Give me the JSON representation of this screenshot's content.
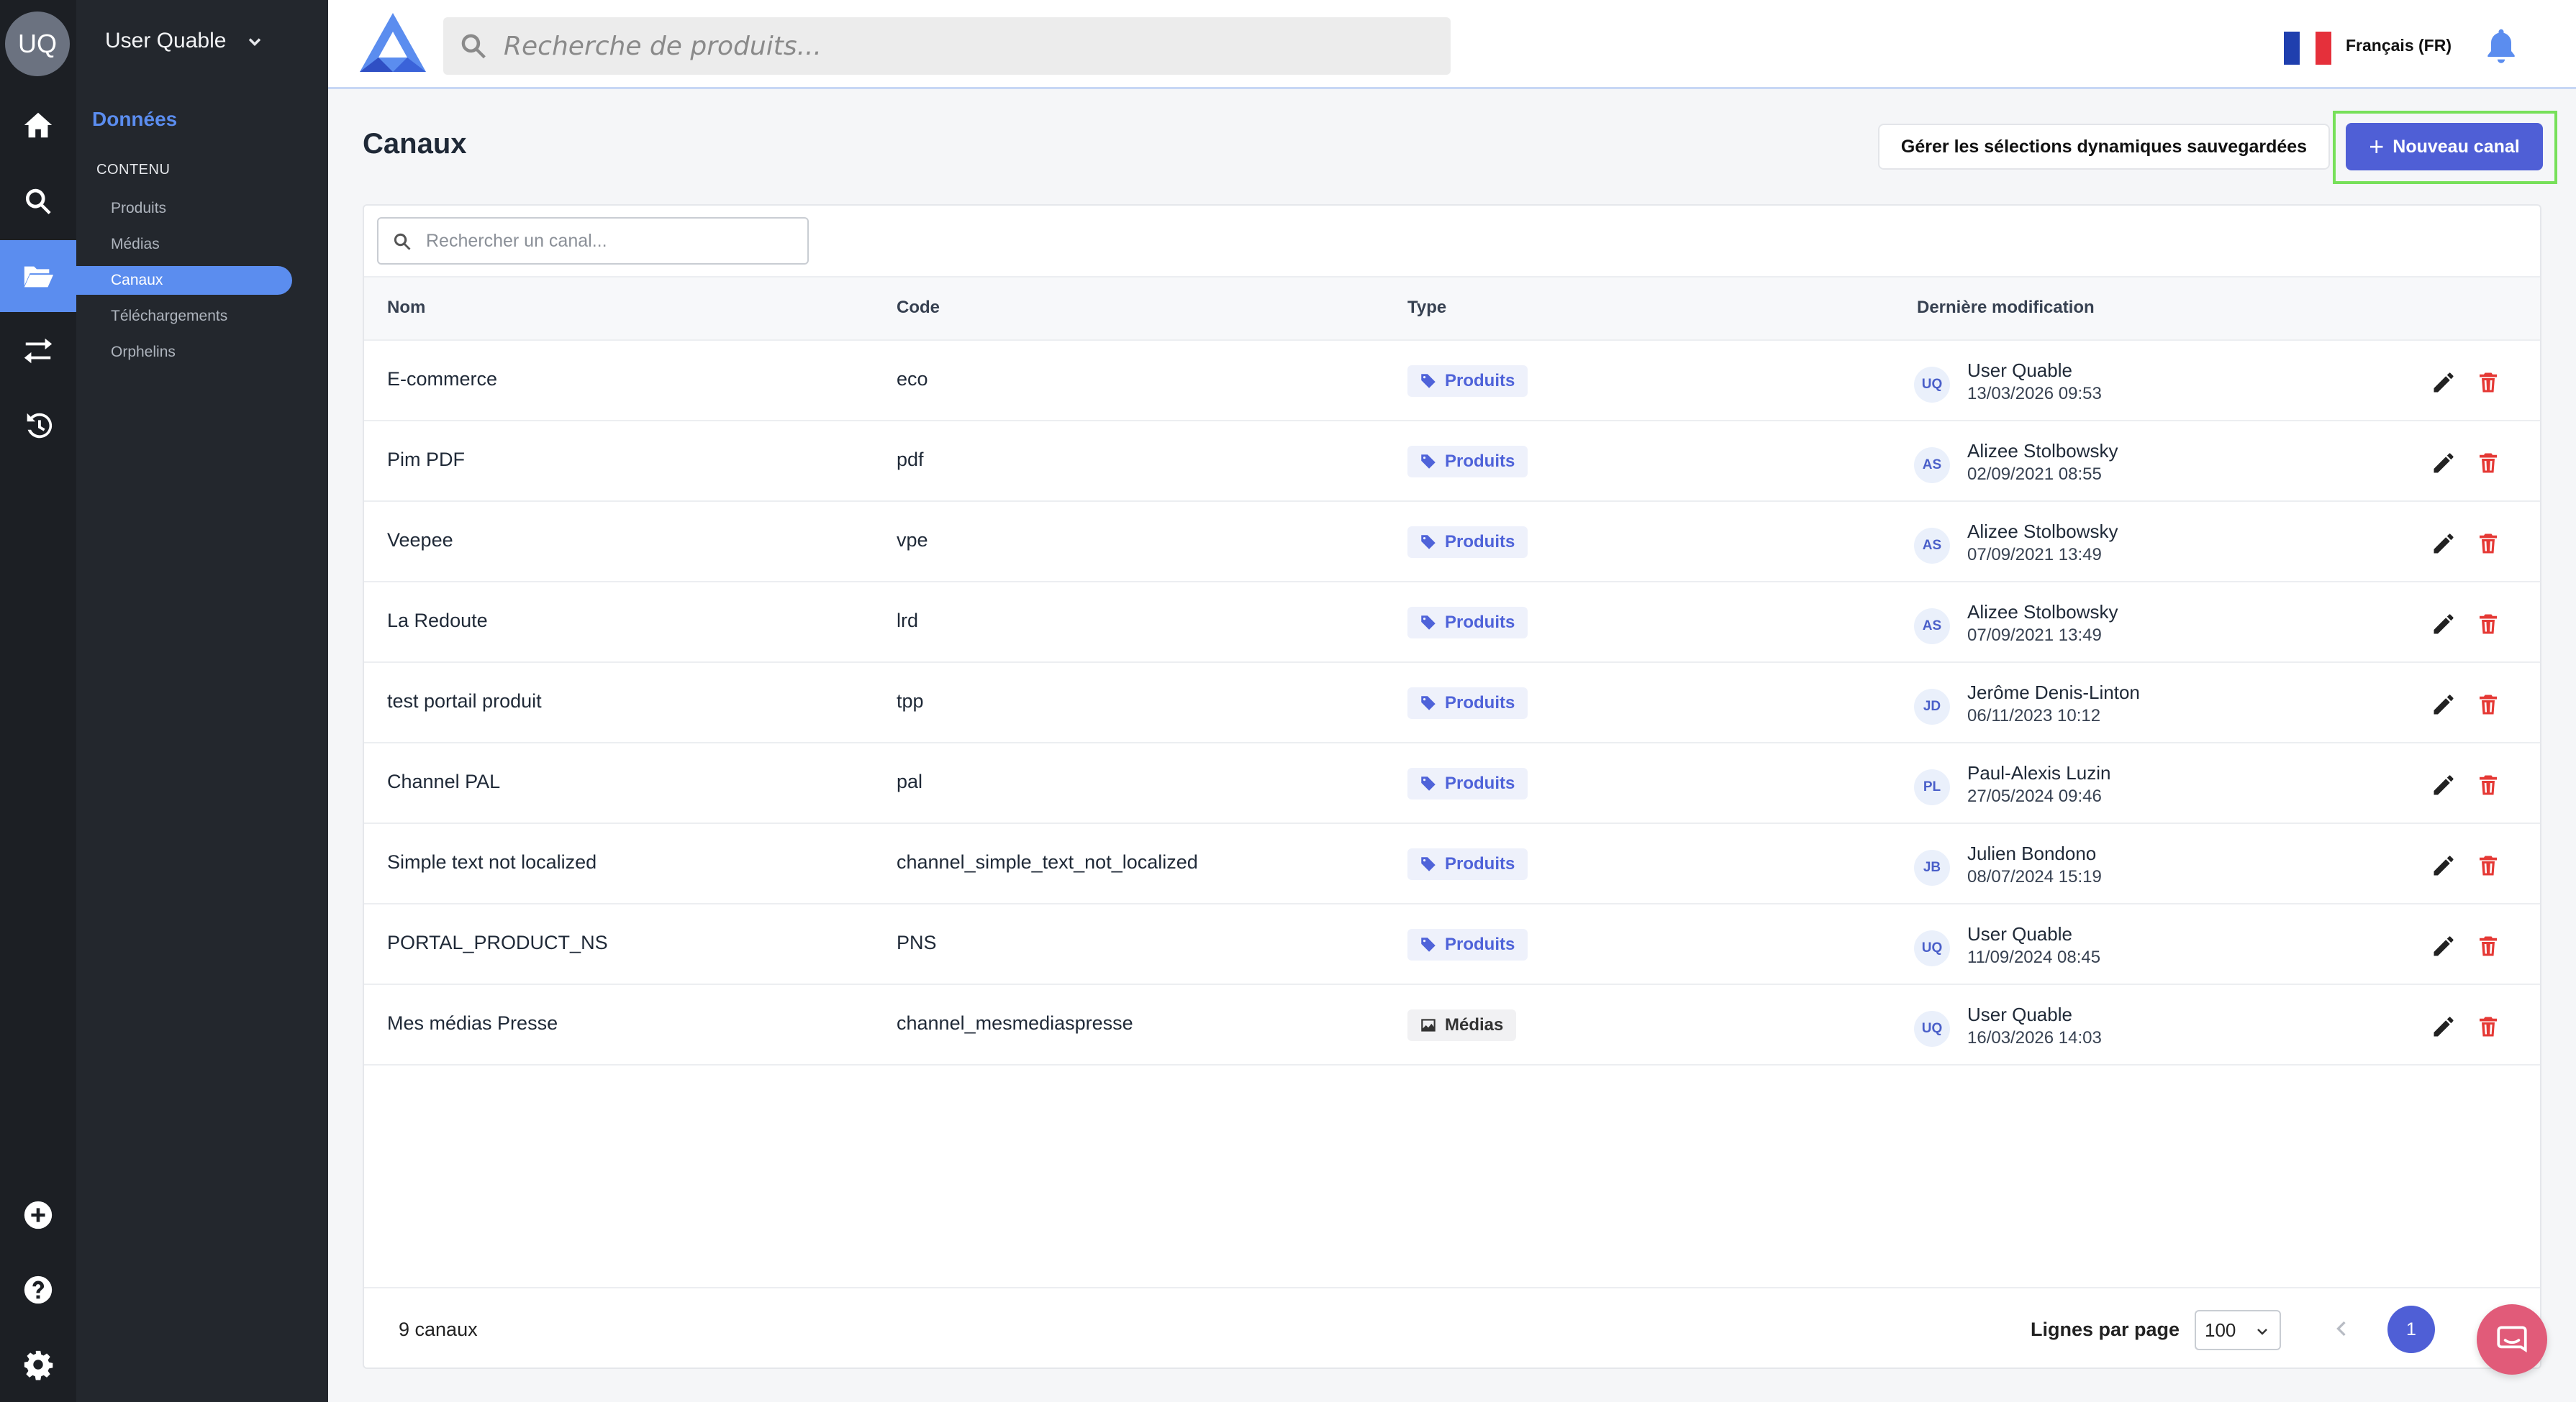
{
  "user": {
    "initials": "UQ",
    "name": "User Quable"
  },
  "sidebar": {
    "section_title": "Données",
    "group_title": "CONTENU",
    "items": [
      {
        "label": "Produits"
      },
      {
        "label": "Médias"
      },
      {
        "label": "Canaux"
      },
      {
        "label": "Téléchargements"
      },
      {
        "label": "Orphelins"
      }
    ]
  },
  "rail_icons": [
    "home-icon",
    "search-icon",
    "folder-open-icon",
    "swap-arrows-icon",
    "history-icon",
    "plus-circle-icon",
    "help-circle-icon",
    "gear-icon"
  ],
  "topbar": {
    "search_placeholder": "Recherche de produits...",
    "language": "Français (FR)"
  },
  "page": {
    "title": "Canaux",
    "manage_button": "Gérer les sélections dynamiques sauvegardées",
    "new_button": "Nouveau canal",
    "filter_placeholder": "Rechercher un canal..."
  },
  "table": {
    "columns": {
      "name": "Nom",
      "code": "Code",
      "type": "Type",
      "modified": "Dernière modification"
    },
    "rows": [
      {
        "name": "E-commerce",
        "code": "eco",
        "type": "Produits",
        "initials": "UQ",
        "user": "User Quable",
        "date": "13/03/2026 09:53"
      },
      {
        "name": "Pim PDF",
        "code": "pdf",
        "type": "Produits",
        "initials": "AS",
        "user": "Alizee Stolbowsky",
        "date": "02/09/2021 08:55"
      },
      {
        "name": "Veepee",
        "code": "vpe",
        "type": "Produits",
        "initials": "AS",
        "user": "Alizee Stolbowsky",
        "date": "07/09/2021 13:49"
      },
      {
        "name": "La Redoute",
        "code": "lrd",
        "type": "Produits",
        "initials": "AS",
        "user": "Alizee Stolbowsky",
        "date": "07/09/2021 13:49"
      },
      {
        "name": "test portail produit",
        "code": "tpp",
        "type": "Produits",
        "initials": "JD",
        "user": "Jerôme Denis-Linton",
        "date": "06/11/2023 10:12"
      },
      {
        "name": "Channel PAL",
        "code": "pal",
        "type": "Produits",
        "initials": "PL",
        "user": "Paul-Alexis Luzin",
        "date": "27/05/2024 09:46"
      },
      {
        "name": "Simple text not localized",
        "code": "channel_simple_text_not_localized",
        "type": "Produits",
        "initials": "JB",
        "user": "Julien Bondono",
        "date": "08/07/2024 15:19"
      },
      {
        "name": "PORTAL_PRODUCT_NS",
        "code": "PNS",
        "type": "Produits",
        "initials": "UQ",
        "user": "User Quable",
        "date": "11/09/2024 08:45"
      },
      {
        "name": "Mes médias Presse",
        "code": "channel_mesmediaspresse",
        "type": "Médias",
        "initials": "UQ",
        "user": "User Quable",
        "date": "16/03/2026 14:03"
      }
    ]
  },
  "footer": {
    "count": "9 canaux",
    "rows_per_page_label": "Lignes par page",
    "rows_per_page_value": "100",
    "current_page": "1"
  },
  "colors": {
    "accent": "#4f5fd6",
    "sidebar_active": "#5b8def",
    "delete": "#e53935",
    "highlight_border": "#77e05a"
  }
}
